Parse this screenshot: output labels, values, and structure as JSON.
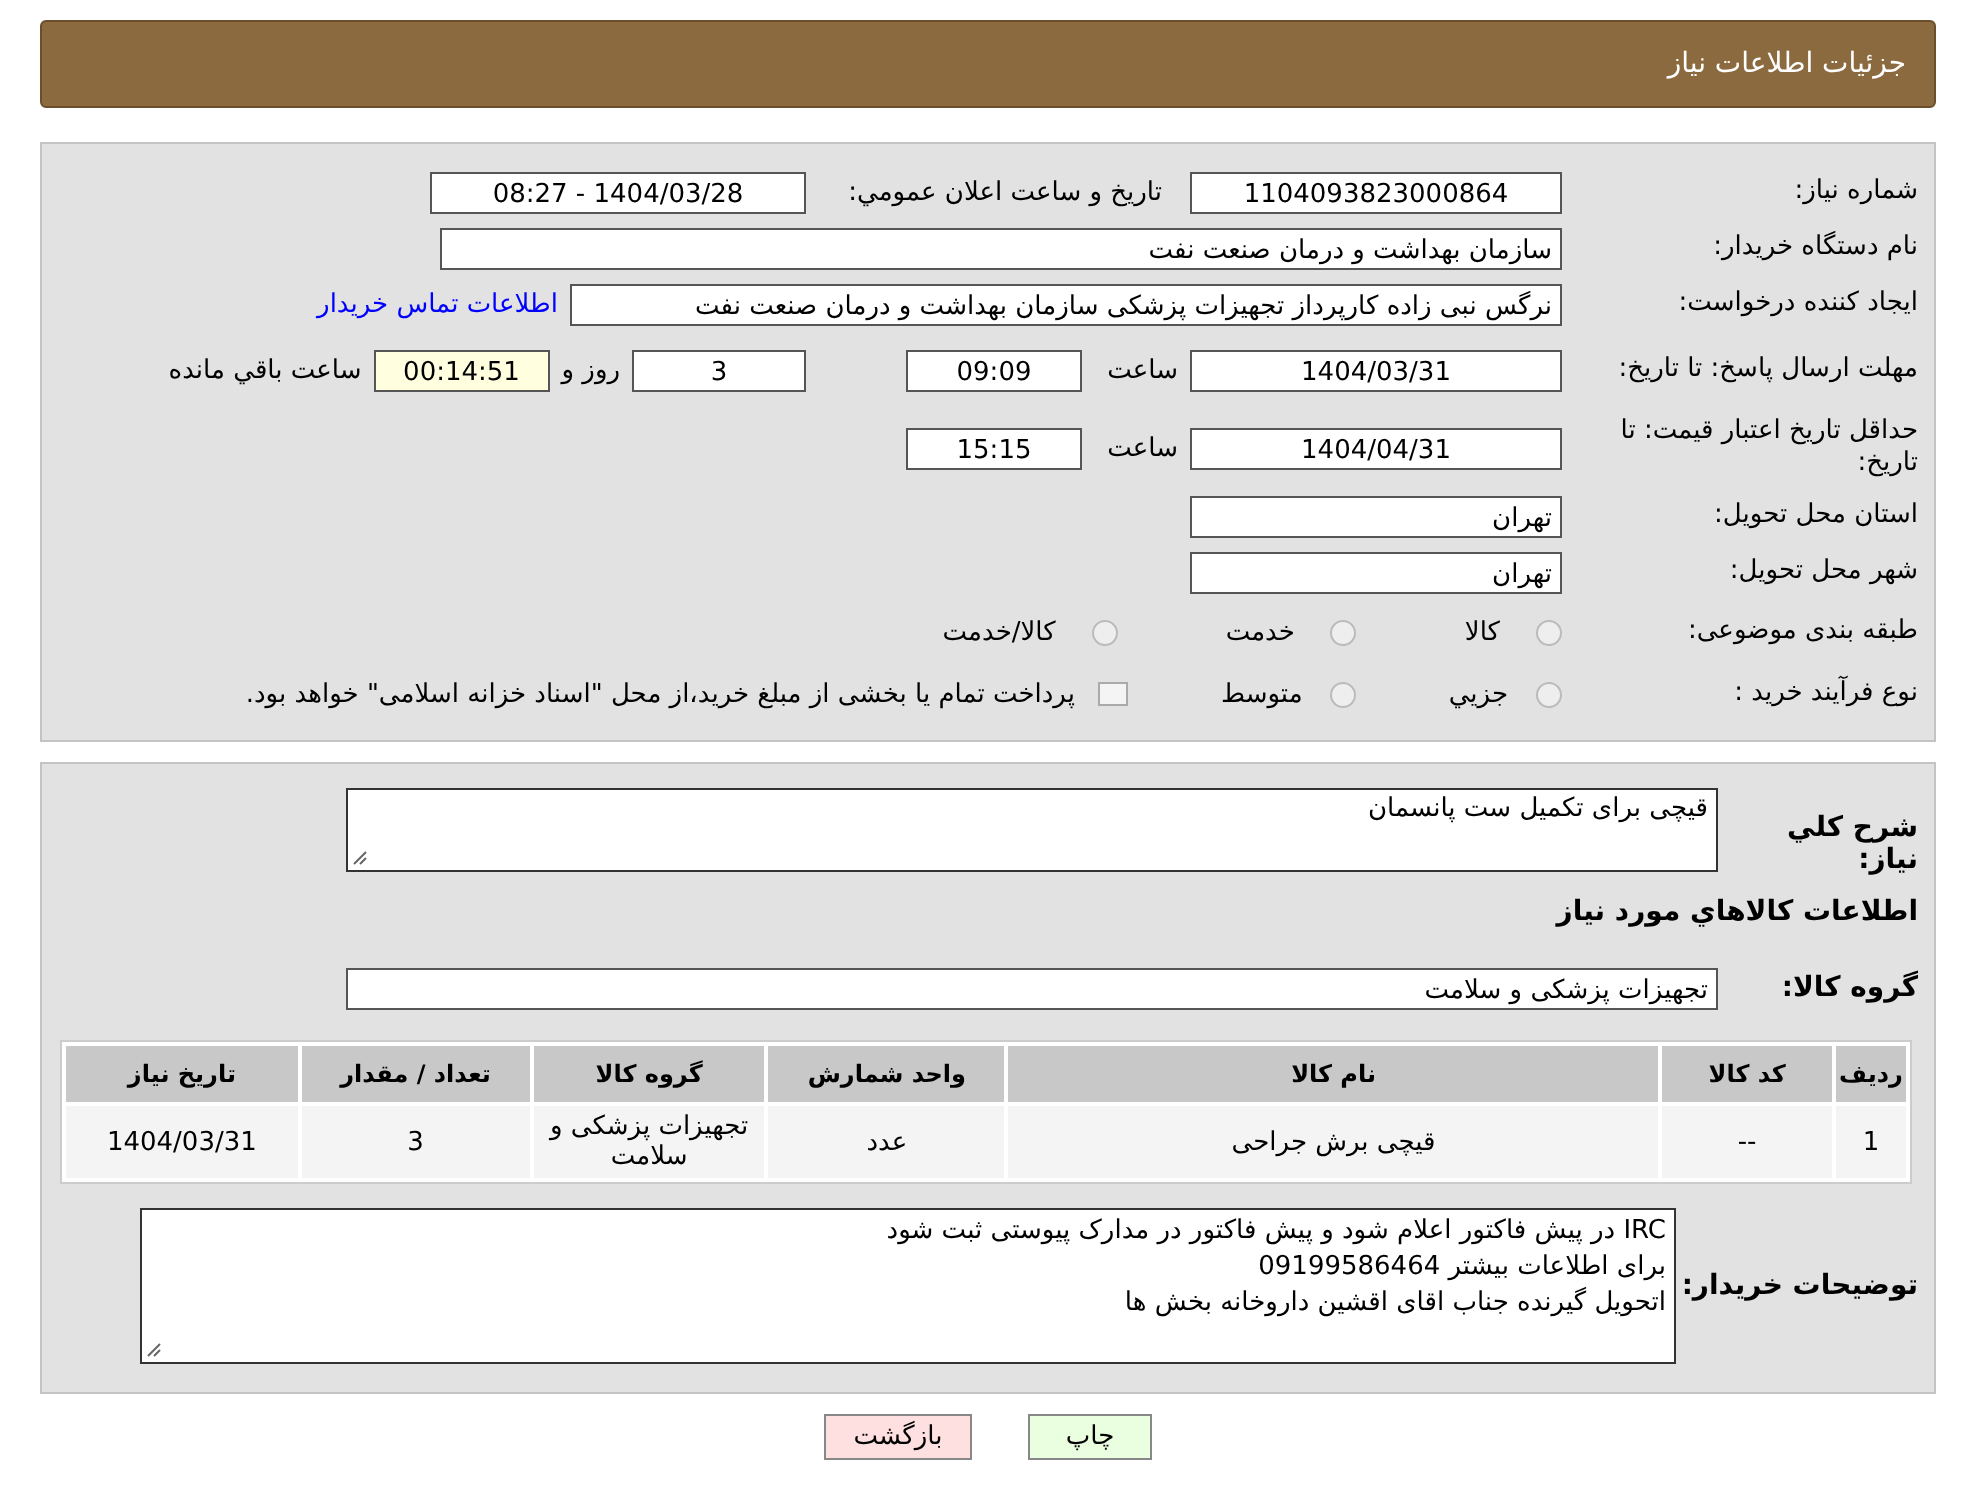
{
  "header": {
    "title": "جزئیات اطلاعات نیاز"
  },
  "need_number": {
    "label": "شماره نیاز:",
    "value": "1104093823000864"
  },
  "announce": {
    "label": "تاریخ و ساعت اعلان عمومي:",
    "value": "1404/03/28 - 08:27"
  },
  "buyer_org": {
    "label": "نام دستگاه خریدار:",
    "value": "سازمان بهداشت و درمان صنعت نفت"
  },
  "requester": {
    "label": "ایجاد کننده درخواست:",
    "value": "نرگس نبی زاده کارپرداز تجهیزات پزشکی سازمان بهداشت و درمان صنعت نفت",
    "link": "اطلاعات تماس خریدار"
  },
  "deadline": {
    "label": "مهلت ارسال پاسخ: تا تاریخ:",
    "date": "1404/03/31",
    "time_label": "ساعت",
    "time": "09:09",
    "days": "3",
    "days_label": "روز و",
    "remaining": "00:14:51",
    "remaining_label": "ساعت باقي مانده"
  },
  "validity": {
    "label": "حداقل تاریخ اعتبار قیمت: تا تاریخ:",
    "date": "1404/04/31",
    "time_label": "ساعت",
    "time": "15:15"
  },
  "province": {
    "label": "استان محل تحویل:",
    "value": "تهران"
  },
  "city": {
    "label": "شهر محل تحویل:",
    "value": "تهران"
  },
  "category": {
    "label": "طبقه بندی موضوعی:",
    "options": [
      {
        "label": "کالا",
        "selected": false
      },
      {
        "label": "خدمت",
        "selected": false
      },
      {
        "label": "کالا/خدمت",
        "selected": false
      }
    ]
  },
  "process": {
    "label": "نوع فرآیند خرید :",
    "options": [
      {
        "kind": "radio",
        "label": "جزيي",
        "selected": false
      },
      {
        "kind": "radio",
        "label": "متوسط",
        "selected": false
      },
      {
        "kind": "checkbox",
        "label": "پرداخت تمام یا بخشی از مبلغ خرید،از محل \"اسناد خزانه اسلامی\" خواهد بود.",
        "checked": false
      }
    ]
  },
  "description": {
    "label": "شرح کلي نیاز:",
    "value": "قیچی برای تکمیل ست پانسمان"
  },
  "goods_title": "اطلاعات کالاهاي مورد نیاز",
  "goods_group": {
    "label": "گروه کالا:",
    "value": "تجهیزات پزشکی و سلامت"
  },
  "table": {
    "columns": [
      "ردیف",
      "کد کالا",
      "نام کالا",
      "واحد شمارش",
      "گروه کالا",
      "تعداد / مقدار",
      "تاریخ نیاز"
    ],
    "rows": [
      [
        "1",
        "--",
        "قیچی برش جراحی",
        "عدد",
        "تجهیزات پزشکی و سلامت",
        "3",
        "1404/03/31"
      ]
    ]
  },
  "buyer_notes": {
    "label": "توضیحات خریدار:",
    "lines": [
      "IRC در پیش فاکتور اعلام شود و پیش فاکتور در مدارک پیوستی ثبت شود",
      "برای اطلاعات بیشتر 09199586464",
      "اتحویل گیرنده جناب اقای اقشین داروخانه بخش ها"
    ]
  },
  "buttons": [
    {
      "kind": "print",
      "label": "چاپ"
    },
    {
      "kind": "back",
      "label": "بازگشت"
    }
  ]
}
